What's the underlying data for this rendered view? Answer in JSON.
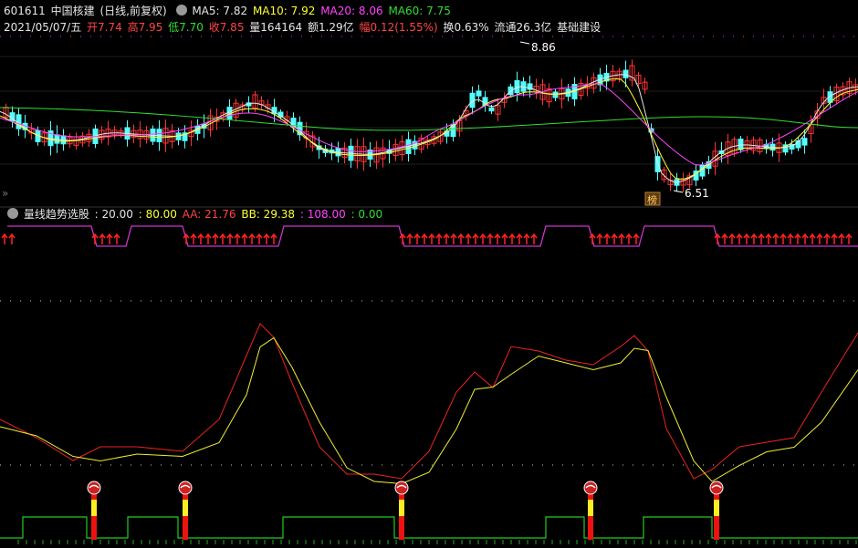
{
  "header": {
    "code": "601611",
    "name": "中国核建",
    "mode": "(日线,前复权)",
    "ma": [
      {
        "label": "MA5: 7.82",
        "color": "#e6e6e6"
      },
      {
        "label": "MA10: 7.92",
        "color": "#ffff33"
      },
      {
        "label": "MA20: 8.06",
        "color": "#ff44ff"
      },
      {
        "label": "MA60: 7.75",
        "color": "#33dd33"
      }
    ]
  },
  "quote": {
    "date": "2021/05/07/五",
    "open": "开7.74",
    "high": "高7.95",
    "low": "低7.70",
    "close": "收7.85",
    "volume": "量164164",
    "amount": "额1.29亿",
    "change": "幅0.12(1.55%)",
    "turnover": "换0.63%",
    "float": "流通26.3亿",
    "sector": "基础建设"
  },
  "price_chart": {
    "high_label": "8.86",
    "low_label": "6.51",
    "badge": "榜"
  },
  "indicator": {
    "name": "量线趋势选股",
    "v1": ": 20.00",
    "v2": ": 80.00",
    "aa": "AA: 21.76",
    "bb": "BB: 29.38",
    "v3": ": 108.00",
    "v4": ": 0.00"
  },
  "colors": {
    "up": "#ff3333",
    "down": "#55ffff",
    "ma5": "#e6e6e6",
    "ma10": "#ffff33",
    "ma20": "#ff44ff",
    "ma60": "#33dd33"
  }
}
